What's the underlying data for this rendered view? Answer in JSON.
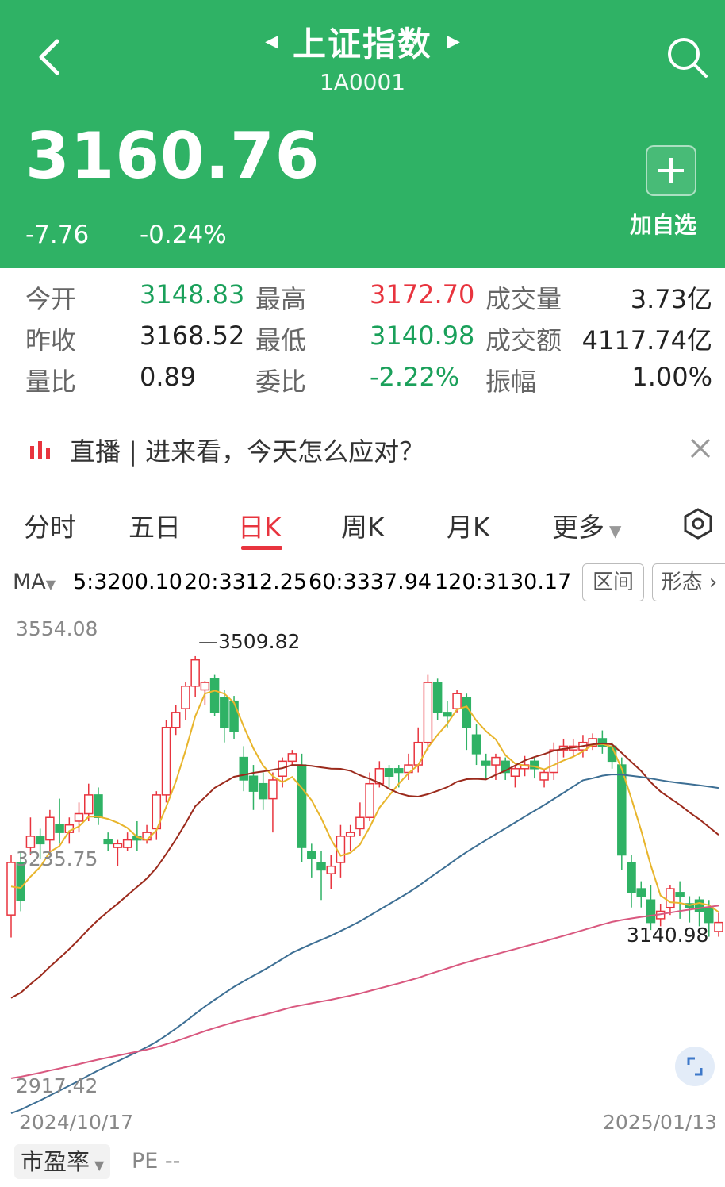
{
  "header": {
    "title": "上证指数",
    "code": "1A0001",
    "price": "3160.76",
    "change": "-7.76",
    "change_pct": "-0.24%",
    "add_label": "加自选",
    "bg_color": "#2fb265"
  },
  "stats": [
    [
      {
        "label": "今开",
        "value": "3148.83",
        "color": "#1aa05a"
      },
      {
        "label": "最高",
        "value": "3172.70",
        "color": "#e8343e"
      },
      {
        "label": "成交量",
        "value": "3.73亿",
        "color": "#222222"
      }
    ],
    [
      {
        "label": "昨收",
        "value": "3168.52",
        "color": "#222222"
      },
      {
        "label": "最低",
        "value": "3140.98",
        "color": "#1aa05a"
      },
      {
        "label": "成交额",
        "value": "4117.74亿",
        "color": "#222222"
      }
    ],
    [
      {
        "label": "量比",
        "value": "0.89",
        "color": "#222222"
      },
      {
        "label": "委比",
        "value": "-2.22%",
        "color": "#1aa05a"
      },
      {
        "label": "振幅",
        "value": "1.00%",
        "color": "#222222"
      }
    ]
  ],
  "live": {
    "text": "直播 | 进来看，今天怎么应对？"
  },
  "tabs": [
    "分时",
    "五日",
    "日K",
    "周K",
    "月K",
    "更多"
  ],
  "active_tab": "日K",
  "ma": {
    "label": "MA",
    "items": [
      {
        "text": "5:3200.10",
        "color": "#e8b52c"
      },
      {
        "text": "20:3312.25",
        "color": "#9b2a1c"
      },
      {
        "text": "60:3337.94",
        "color": "#3d6f94"
      },
      {
        "text": "120:3130.17",
        "color": "#d9587f"
      }
    ],
    "btn_range": "区间",
    "btn_pattern": "形态"
  },
  "chart_data": {
    "type": "candlestick",
    "y_top": "3554.08",
    "y_mid": "3235.75",
    "y_bottom": "2917.42",
    "x_start": "2024/10/17",
    "x_end": "2025/01/13",
    "high_label": "3509.82",
    "low_label": "3140.98",
    "up_color": "#e8343e",
    "down_color": "#2fb265",
    "ylim": [
      2917.42,
      3554.08
    ],
    "candles": [
      [
        3170,
        3240,
        3140,
        3250
      ],
      [
        3240,
        3190,
        3175,
        3255
      ],
      [
        3260,
        3275,
        3250,
        3300
      ],
      [
        3275,
        3265,
        3245,
        3285
      ],
      [
        3270,
        3300,
        3250,
        3310
      ],
      [
        3290,
        3280,
        3265,
        3325
      ],
      [
        3280,
        3290,
        3265,
        3300
      ],
      [
        3295,
        3305,
        3280,
        3320
      ],
      [
        3305,
        3330,
        3295,
        3345
      ],
      [
        3330,
        3300,
        3290,
        3340
      ],
      [
        3270,
        3265,
        3255,
        3280
      ],
      [
        3260,
        3265,
        3235,
        3270
      ],
      [
        3260,
        3270,
        3255,
        3280
      ],
      [
        3275,
        3270,
        3255,
        3295
      ],
      [
        3270,
        3280,
        3265,
        3290
      ],
      [
        3285,
        3330,
        3270,
        3335
      ],
      [
        3330,
        3420,
        3320,
        3430
      ],
      [
        3420,
        3440,
        3410,
        3450
      ],
      [
        3445,
        3475,
        3430,
        3480
      ],
      [
        3475,
        3510,
        3460,
        3515
      ],
      [
        3470,
        3480,
        3450,
        3482
      ],
      [
        3485,
        3440,
        3435,
        3490
      ],
      [
        3460,
        3420,
        3400,
        3470
      ],
      [
        3455,
        3415,
        3405,
        3462
      ],
      [
        3380,
        3350,
        3335,
        3395
      ],
      [
        3355,
        3335,
        3310,
        3370
      ],
      [
        3345,
        3325,
        3310,
        3360
      ],
      [
        3325,
        3350,
        3280,
        3360
      ],
      [
        3355,
        3375,
        3340,
        3380
      ],
      [
        3375,
        3385,
        3370,
        3390
      ],
      [
        3370,
        3260,
        3240,
        3385
      ],
      [
        3255,
        3245,
        3220,
        3265
      ],
      [
        3240,
        3230,
        3190,
        3255
      ],
      [
        3225,
        3235,
        3205,
        3250
      ],
      [
        3240,
        3275,
        3220,
        3290
      ],
      [
        3275,
        3280,
        3255,
        3290
      ],
      [
        3285,
        3300,
        3275,
        3320
      ],
      [
        3300,
        3345,
        3295,
        3360
      ],
      [
        3345,
        3365,
        3340,
        3375
      ],
      [
        3365,
        3355,
        3340,
        3370
      ],
      [
        3365,
        3360,
        3340,
        3370
      ],
      [
        3360,
        3370,
        3350,
        3385
      ],
      [
        3370,
        3400,
        3360,
        3420
      ],
      [
        3400,
        3480,
        3390,
        3490
      ],
      [
        3480,
        3440,
        3430,
        3485
      ],
      [
        3440,
        3435,
        3420,
        3455
      ],
      [
        3445,
        3465,
        3440,
        3470
      ],
      [
        3460,
        3420,
        3390,
        3465
      ],
      [
        3410,
        3385,
        3370,
        3425
      ],
      [
        3375,
        3370,
        3350,
        3385
      ],
      [
        3370,
        3380,
        3350,
        3385
      ],
      [
        3375,
        3360,
        3350,
        3380
      ],
      [
        3355,
        3365,
        3340,
        3370
      ],
      [
        3365,
        3370,
        3355,
        3382
      ],
      [
        3375,
        3365,
        3352,
        3380
      ],
      [
        3350,
        3360,
        3340,
        3365
      ],
      [
        3360,
        3390,
        3350,
        3400
      ],
      [
        3390,
        3395,
        3380,
        3405
      ],
      [
        3390,
        3395,
        3380,
        3405
      ],
      [
        3390,
        3400,
        3380,
        3410
      ],
      [
        3395,
        3405,
        3390,
        3412
      ],
      [
        3405,
        3395,
        3385,
        3416
      ],
      [
        3395,
        3375,
        3365,
        3400
      ],
      [
        3370,
        3250,
        3230,
        3380
      ],
      [
        3240,
        3200,
        3180,
        3250
      ],
      [
        3205,
        3195,
        3180,
        3215
      ],
      [
        3190,
        3160,
        3150,
        3210
      ],
      [
        3165,
        3175,
        3155,
        3185
      ],
      [
        3180,
        3205,
        3170,
        3210
      ],
      [
        3200,
        3195,
        3165,
        3215
      ],
      [
        3185,
        3180,
        3160,
        3195
      ],
      [
        3190,
        3175,
        3155,
        3195
      ],
      [
        3180,
        3160,
        3141,
        3190
      ],
      [
        3148,
        3160,
        3141,
        3173
      ]
    ]
  },
  "bottom": {
    "pe_btn": "市盈率",
    "pe_val": "PE --"
  }
}
